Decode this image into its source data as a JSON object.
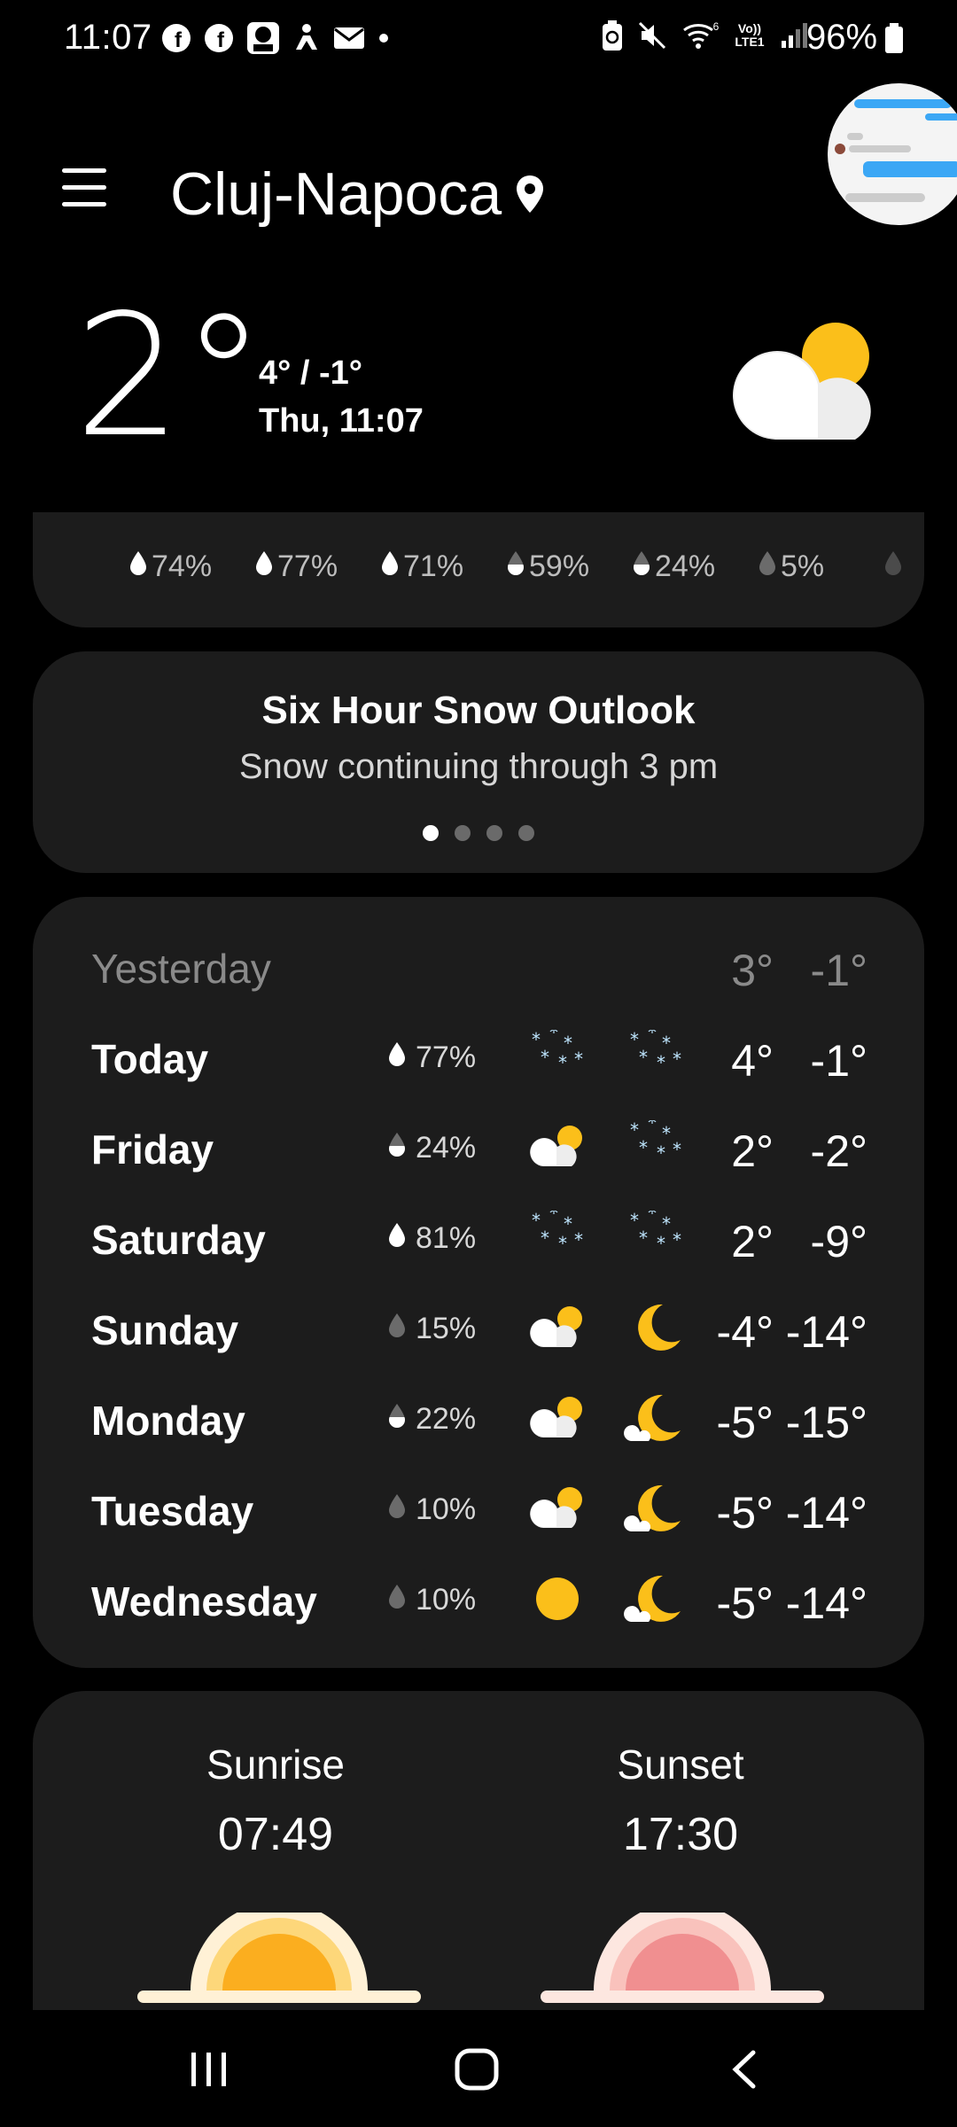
{
  "status_bar": {
    "time": "11:07",
    "battery": "96%",
    "left_icons": [
      "facebook-icon",
      "facebook-icon",
      "lidl-plus-icon",
      "accessibility-icon",
      "mail-icon",
      "dot-icon"
    ],
    "right_icons": [
      "battery-saver-icon",
      "mute-icon",
      "wifi-6-icon",
      "volte-icon",
      "signal-icon",
      "battery-icon"
    ],
    "volte_label": "Vo)) LTE1"
  },
  "header": {
    "city": "Cluj-Napoca",
    "menu_icon": "hamburger-menu-icon",
    "location_icon": "location-pin-icon"
  },
  "current": {
    "temp": "2°",
    "hi_lo": "4° / -1°",
    "day_time": "Thu, 11:07",
    "icon": "partly-cloudy-icon"
  },
  "precip_strip": [
    "74%",
    "77%",
    "71%",
    "59%",
    "24%",
    "5%"
  ],
  "outlook": {
    "title": "Six Hour Snow Outlook",
    "subtitle": "Snow continuing through 3 pm",
    "pages": 4,
    "active_page": 1
  },
  "daily": [
    {
      "day": "Yesterday",
      "pop": "",
      "hi": "3°",
      "lo": "-1°"
    },
    {
      "day": "Today",
      "pop": "77%",
      "day_icon": "snow-icon",
      "night_icon": "snow-icon",
      "hi": "4°",
      "lo": "-1°"
    },
    {
      "day": "Friday",
      "pop": "24%",
      "day_icon": "partly-cloudy-icon",
      "night_icon": "snow-icon",
      "hi": "2°",
      "lo": "-2°"
    },
    {
      "day": "Saturday",
      "pop": "81%",
      "day_icon": "snow-icon",
      "night_icon": "snow-icon",
      "hi": "2°",
      "lo": "-9°"
    },
    {
      "day": "Sunday",
      "pop": "15%",
      "day_icon": "partly-cloudy-icon",
      "night_icon": "moon-icon",
      "hi": "-4°",
      "lo": "-14°"
    },
    {
      "day": "Monday",
      "pop": "22%",
      "day_icon": "partly-cloudy-icon",
      "night_icon": "moon-cloud-icon",
      "hi": "-5°",
      "lo": "-15°"
    },
    {
      "day": "Tuesday",
      "pop": "10%",
      "day_icon": "partly-cloudy-icon",
      "night_icon": "moon-cloud-icon",
      "hi": "-5°",
      "lo": "-14°"
    },
    {
      "day": "Wednesday",
      "pop": "10%",
      "day_icon": "sun-icon",
      "night_icon": "moon-cloud-icon",
      "hi": "-5°",
      "lo": "-14°"
    }
  ],
  "sun": {
    "sunrise_label": "Sunrise",
    "sunrise_time": "07:49",
    "sunset_label": "Sunset",
    "sunset_time": "17:30"
  },
  "colors": {
    "background": "#000000",
    "card": "#1c1c1c",
    "sun_yellow": "#fbbf1a",
    "snow_blue": "#bfe6ff",
    "sunset_pink": "#f08f90"
  }
}
